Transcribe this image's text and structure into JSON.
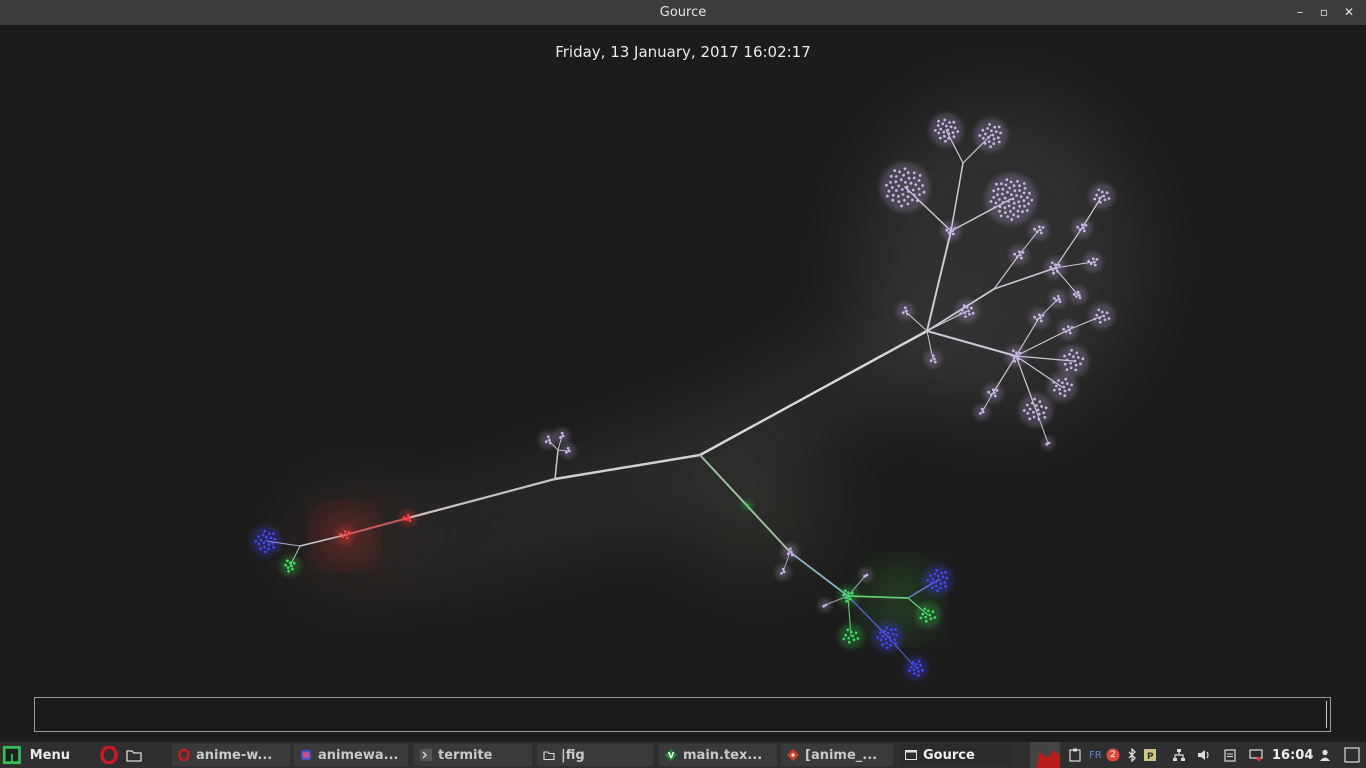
{
  "window": {
    "title": "Gource",
    "controls": {
      "minimize": "–",
      "maximize": "▫",
      "close": "✕"
    }
  },
  "visualization": {
    "datetime": "Friday, 13 January, 2017 16:02:17"
  },
  "command_input": {
    "value": ""
  },
  "taskbar": {
    "menu_label": "Menu",
    "tasks": [
      {
        "label": "anime-w...",
        "icon": "opera-icon",
        "active": false
      },
      {
        "label": "animewa...",
        "icon": "app-icon",
        "active": false
      },
      {
        "label": "termite",
        "icon": "terminal-icon",
        "active": false
      },
      {
        "label": "|fig",
        "icon": "folder-icon",
        "active": false
      },
      {
        "label": "main.tex...",
        "icon": "vim-icon",
        "active": false
      },
      {
        "label": "[anime_...",
        "icon": "git-icon",
        "active": false
      },
      {
        "label": "Gource",
        "icon": "window-icon",
        "active": true
      }
    ],
    "tray": {
      "keyboard_layout": "FR",
      "notification_count": "2",
      "clock": "16:04"
    }
  },
  "colors": {
    "titlebar_bg": "#3c3c3c",
    "taskbar_bg": "#2f2f2f",
    "background": "#1c1c1c",
    "accent_manjaro": "#35bf5c",
    "opera_red": "#cc1b24",
    "branch": "#d8d8d8",
    "file_lavender": "#c8b4e6",
    "file_blue": "#4646ff",
    "file_green": "#3cdc5a",
    "file_red": "#ff4040"
  }
}
